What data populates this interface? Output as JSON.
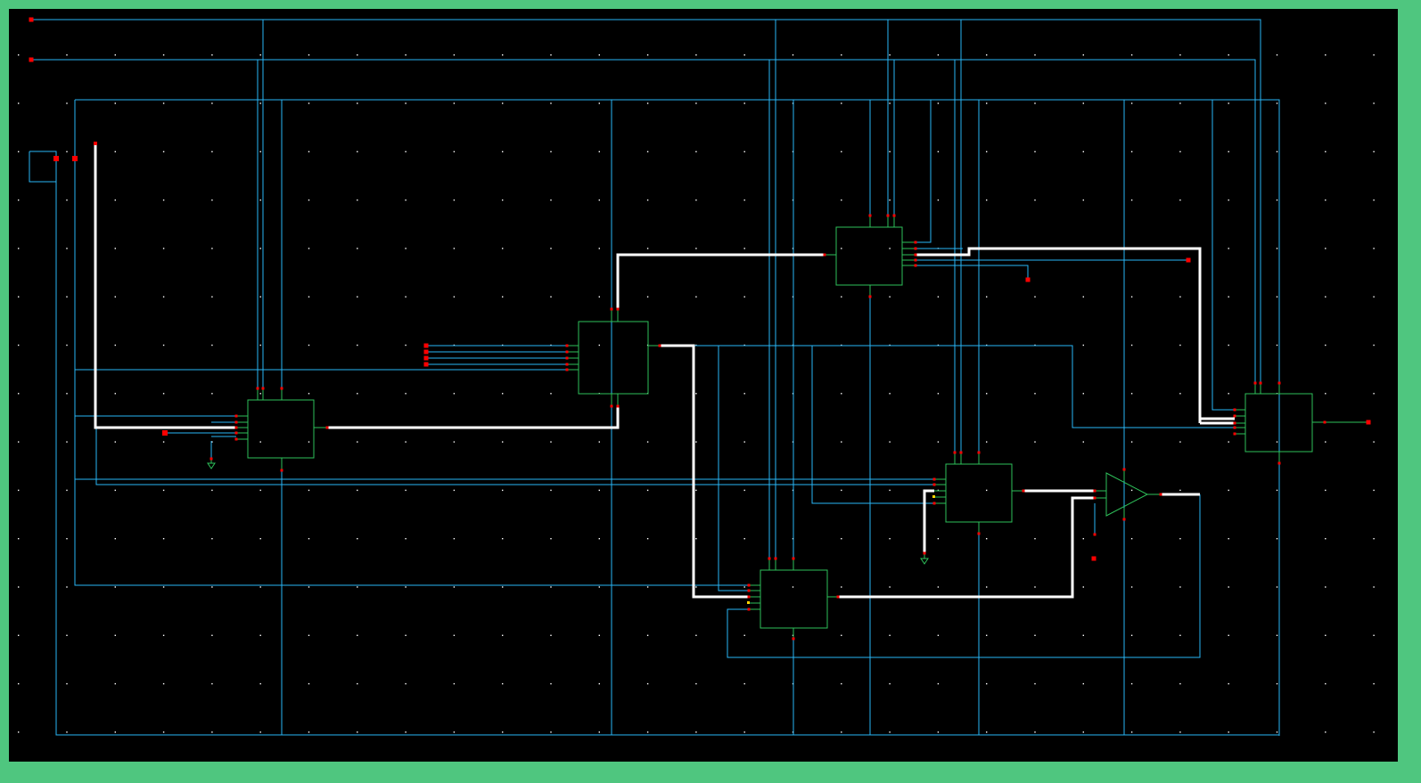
{
  "app": {
    "type": "schematic-editor"
  },
  "colors": {
    "frame": "#4fc67f",
    "canvas_bg": "#000000",
    "grid_dot": "#ffffff",
    "wire": "#29b6f6",
    "bus": "#ffffff",
    "symbol_outline": "#2ec05a",
    "pin": "#ff0000"
  },
  "icons": [
    "ground-icon",
    "opamp-symbol",
    "block-symbol",
    "pin-marker"
  ],
  "symbols": [
    {
      "name": "block-u1"
    },
    {
      "name": "block-u2"
    },
    {
      "name": "block-u3"
    },
    {
      "name": "block-u4"
    },
    {
      "name": "block-u5"
    },
    {
      "name": "block-u6"
    },
    {
      "name": "opamp-u7"
    }
  ]
}
